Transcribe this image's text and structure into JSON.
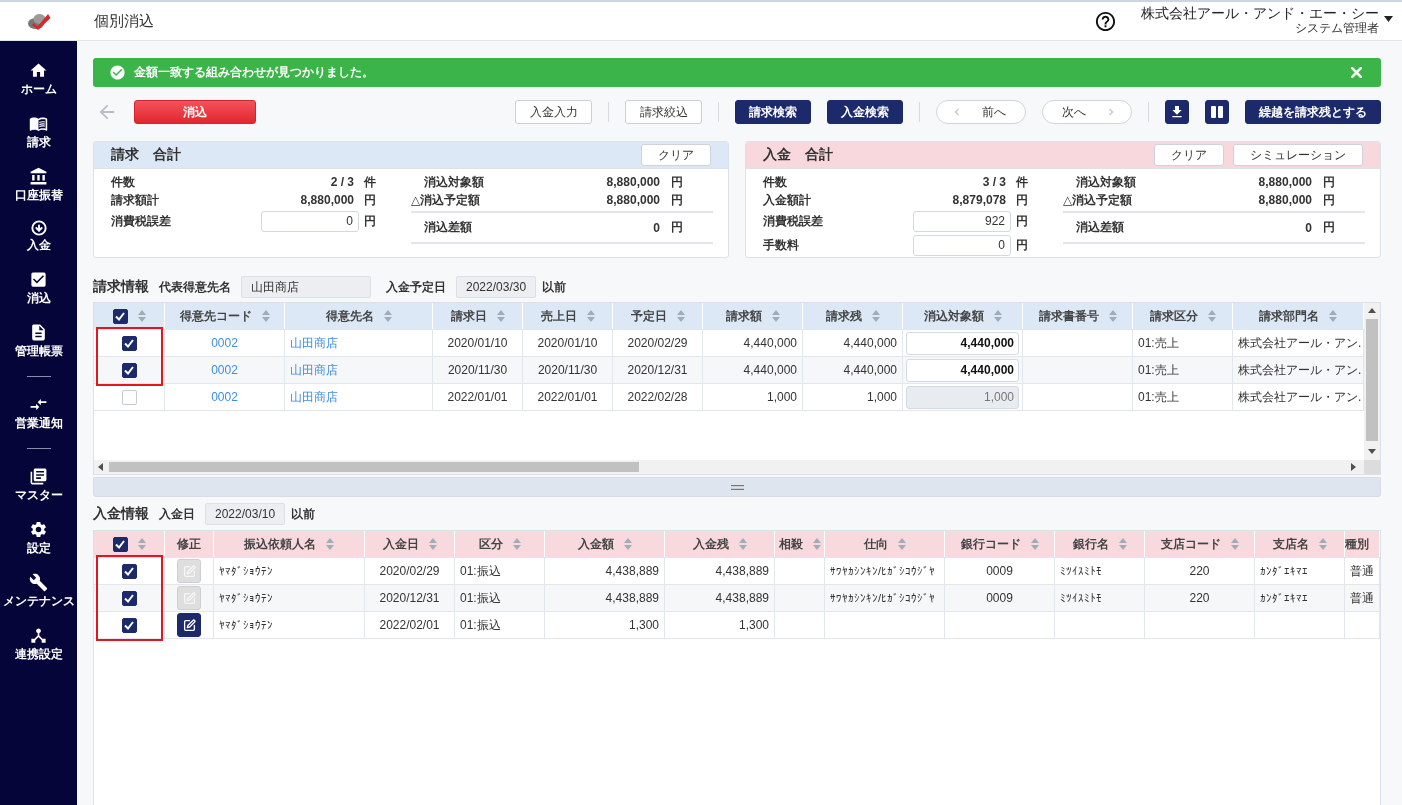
{
  "sidebar": {
    "sections": [
      {
        "items": [
          {
            "kind": "home",
            "label": "ホーム"
          },
          {
            "kind": "invoice",
            "label": "請求"
          },
          {
            "kind": "transfer",
            "label": "口座振替"
          },
          {
            "kind": "payment",
            "label": "入金"
          },
          {
            "kind": "clearing",
            "label": "消込"
          },
          {
            "kind": "reports",
            "label": "管理帳票"
          }
        ]
      },
      {
        "items": [
          {
            "kind": "notice",
            "label": "営業通知"
          }
        ]
      },
      {
        "items": [
          {
            "kind": "master",
            "label": "マスター"
          },
          {
            "kind": "settings",
            "label": "設定"
          },
          {
            "kind": "maintenance",
            "label": "メンテナンス"
          },
          {
            "kind": "integration",
            "label": "連携設定"
          }
        ]
      }
    ]
  },
  "header": {
    "title": "個別消込",
    "company": "株式会社アール・アンド・エー・シー",
    "user": "システム管理者"
  },
  "alert": {
    "message": "金額一致する組み合わせが見つかりました。"
  },
  "toolbar": {
    "left": [
      {
        "kind": "danger",
        "label": "消込"
      }
    ],
    "groups": [
      {
        "buttons": [
          {
            "kind": "outline",
            "label": "入金入力"
          }
        ]
      },
      {
        "buttons": [
          {
            "kind": "outline",
            "label": "請求絞込"
          }
        ]
      },
      {
        "buttons": [
          {
            "kind": "navy",
            "label": "請求検索"
          },
          {
            "kind": "navy",
            "label": "入金検索"
          }
        ]
      },
      {
        "buttons": [
          {
            "kind": "prev",
            "label": "前へ"
          },
          {
            "kind": "next",
            "label": "次へ"
          }
        ]
      },
      {
        "buttons": [
          {
            "kind": "download"
          },
          {
            "kind": "columns"
          },
          {
            "kind": "navy",
            "label": "繰越を請求残とする"
          }
        ]
      }
    ]
  },
  "summaries": [
    {
      "kind": "invoice",
      "title": "請求　合計",
      "buttons": [
        "クリア"
      ],
      "stats": [
        {
          "kind": "text",
          "label": "件数",
          "value": "2 / 3",
          "unit": "件"
        },
        {
          "kind": "text",
          "label": "請求額計",
          "value": "8,880,000",
          "unit": "円"
        },
        {
          "kind": "input",
          "label": "消費税誤差",
          "value": "0",
          "unit": "円"
        }
      ],
      "targets": [
        {
          "kind": "target",
          "label": "消込対象額",
          "value": "8,880,000",
          "unit": "円"
        },
        {
          "kind": "planned",
          "label": "△消込予定額",
          "value": "8,880,000",
          "unit": "円"
        }
      ],
      "difference": {
        "label": "消込差額",
        "value": "0",
        "unit": "円"
      }
    },
    {
      "kind": "payment",
      "title": "入金　合計",
      "buttons": [
        "クリア",
        "シミュレーション"
      ],
      "stats": [
        {
          "kind": "text",
          "label": "件数",
          "value": "3 / 3",
          "unit": "件"
        },
        {
          "kind": "text",
          "label": "入金額計",
          "value": "8,879,078",
          "unit": "円"
        },
        {
          "kind": "input",
          "label": "消費税誤差",
          "value": "922",
          "unit": "円"
        },
        {
          "kind": "input",
          "label": "手数料",
          "value": "0",
          "unit": "円"
        }
      ],
      "targets": [
        {
          "kind": "target",
          "label": "消込対象額",
          "value": "8,880,000",
          "unit": "円"
        },
        {
          "kind": "planned",
          "label": "△消込予定額",
          "value": "8,880,000",
          "unit": "円"
        }
      ],
      "difference": {
        "label": "消込差額",
        "value": "0",
        "unit": "円"
      }
    }
  ],
  "invoice_info": {
    "title": "請求情報",
    "filters": [
      {
        "kind": "text",
        "label": "代表得意先名",
        "value": "山田商店"
      },
      {
        "kind": "date",
        "label": "入金予定日",
        "value": "2022/03/30",
        "suffix": "以前"
      }
    ],
    "table": {
      "select_all_checked": true,
      "columns": [
        {
          "kind": "code",
          "label": "得意先コード"
        },
        {
          "kind": "link",
          "label": "得意先名"
        },
        {
          "kind": "date",
          "label": "請求日"
        },
        {
          "kind": "date",
          "label": "売上日"
        },
        {
          "kind": "date",
          "label": "予定日"
        },
        {
          "kind": "amount",
          "label": "請求額"
        },
        {
          "kind": "amount",
          "label": "請求残"
        },
        {
          "kind": "input",
          "label": "消込対象額"
        },
        {
          "kind": "text",
          "label": "請求書番号"
        },
        {
          "kind": "text",
          "label": "請求区分"
        },
        {
          "kind": "text",
          "label": "請求部門名"
        }
      ],
      "rows": [
        {
          "checked": true,
          "highlighted": true,
          "cells": [
            "0002",
            "山田商店",
            "2020/01/10",
            "2020/01/10",
            "2020/02/29",
            "4,440,000",
            "4,440,000",
            "4,440,000",
            "",
            "01:売上",
            "株式会社アール・アン."
          ]
        },
        {
          "checked": true,
          "highlighted": true,
          "cells": [
            "0002",
            "山田商店",
            "2020/11/30",
            "2020/11/30",
            "2020/12/31",
            "4,440,000",
            "4,440,000",
            "4,440,000",
            "",
            "01:売上",
            "株式会社アール・アン."
          ]
        },
        {
          "checked": false,
          "highlighted": false,
          "cells": [
            "0002",
            "山田商店",
            "2022/01/01",
            "2022/01/01",
            "2022/02/28",
            "1,000",
            "1,000",
            "1,000",
            "",
            "01:売上",
            "株式会社アール・アン."
          ]
        }
      ]
    }
  },
  "payment_info": {
    "title": "入金情報",
    "filters": [
      {
        "kind": "date",
        "label": "入金日",
        "value": "2022/03/10",
        "suffix": "以前"
      }
    ],
    "table": {
      "select_all_checked": true,
      "columns": [
        {
          "kind": "edit",
          "label": "修正"
        },
        {
          "kind": "kana",
          "label": "振込依頼人名"
        },
        {
          "kind": "date",
          "label": "入金日"
        },
        {
          "kind": "text",
          "label": "区分"
        },
        {
          "kind": "amount",
          "label": "入金額"
        },
        {
          "kind": "amount",
          "label": "入金残"
        },
        {
          "kind": "text",
          "label": "相殺"
        },
        {
          "kind": "kana",
          "label": "仕向"
        },
        {
          "kind": "center",
          "label": "銀行コード"
        },
        {
          "kind": "kana",
          "label": "銀行名"
        },
        {
          "kind": "center",
          "label": "支店コード"
        },
        {
          "kind": "kana",
          "label": "支店名"
        },
        {
          "kind": "text",
          "label": "種別"
        }
      ],
      "rows": [
        {
          "checked": true,
          "highlighted": true,
          "edit_disabled": true,
          "cells": [
            "",
            "ﾔﾏﾀﾞｼｮｳﾃﾝ",
            "2020/02/29",
            "01:振込",
            "4,438,889",
            "4,438,889",
            "",
            "ｻﾜﾔｶｼﾝｷﾝ/ﾋｶﾞｼｺｳｼﾞﾔ",
            "0009",
            "ﾐﾂｲｽﾐﾄﾓ",
            "220",
            "ｶﾝﾀﾞｴｷﾏｴ",
            "普通"
          ]
        },
        {
          "checked": true,
          "highlighted": true,
          "edit_disabled": true,
          "cells": [
            "",
            "ﾔﾏﾀﾞｼｮｳﾃﾝ",
            "2020/12/31",
            "01:振込",
            "4,438,889",
            "4,438,889",
            "",
            "ｻﾜﾔｶｼﾝｷﾝ/ﾋｶﾞｼｺｳｼﾞﾔ",
            "0009",
            "ﾐﾂｲｽﾐﾄﾓ",
            "220",
            "ｶﾝﾀﾞｴｷﾏｴ",
            "普通"
          ]
        },
        {
          "checked": true,
          "highlighted": true,
          "edit_disabled": false,
          "cells": [
            "",
            "ﾔﾏﾀﾞｼｮｳﾃﾝ",
            "2022/02/01",
            "01:振込",
            "1,300",
            "1,300"
          ]
        }
      ]
    }
  }
}
